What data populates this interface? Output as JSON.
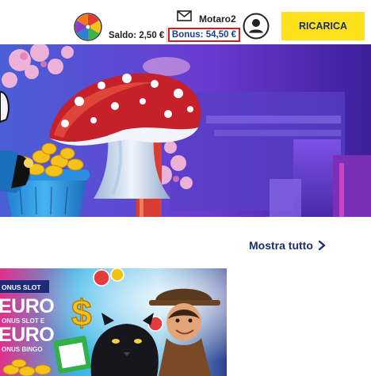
{
  "header": {
    "wheel_icon": "fortune-wheel-icon",
    "balance_label": "Saldo: 2,50 €",
    "username": "Motaro2",
    "mail_icon": "mail-icon",
    "bonus_label": "Bonus: 54,50 €",
    "user_icon": "user-circle-icon",
    "recharge_label": "RICARICA",
    "colors": {
      "recharge_bg": "#ffe11b",
      "bonus_border": "#d0202a",
      "bonus_text": "#1a3e8c",
      "brand_navy": "#1a2e6b"
    }
  },
  "hero": {
    "image": "mushroom-casino-banner"
  },
  "section": {
    "show_all_label": "Mostra tutto",
    "show_all_icon": "chevron-right-icon"
  },
  "promo_card": {
    "tag": "ONUS SLOT",
    "line1": "EURO",
    "line1_sub": "ONUS SLOT E",
    "line2": "EURO",
    "line2_sub": "ONUS BINGO",
    "image": "panther-bingo-promo"
  }
}
